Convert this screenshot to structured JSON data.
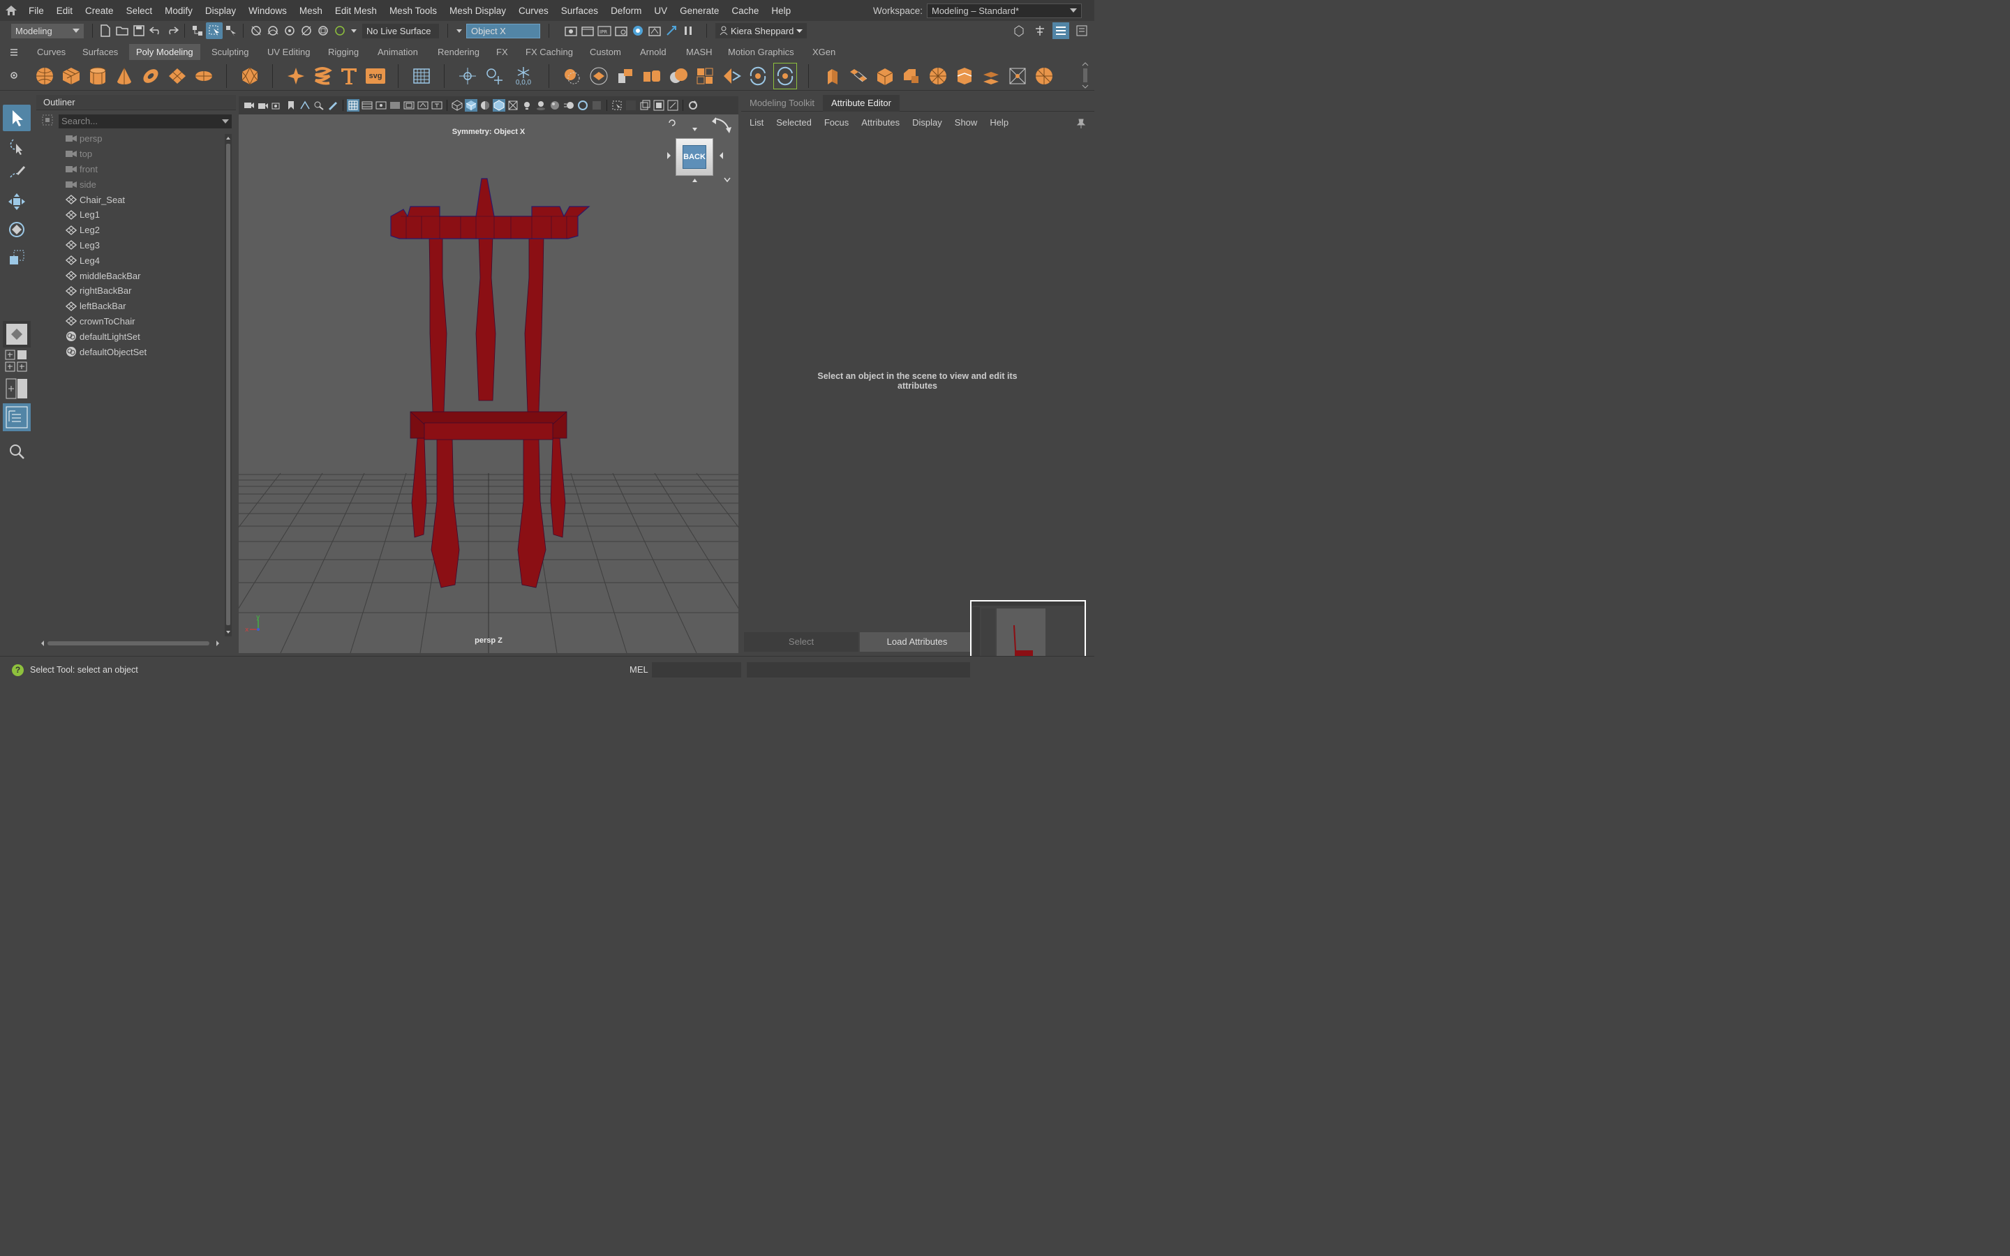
{
  "menubar": {
    "items": [
      "File",
      "Edit",
      "Create",
      "Select",
      "Modify",
      "Display",
      "Windows",
      "Mesh",
      "Edit Mesh",
      "Mesh Tools",
      "Mesh Display",
      "Curves",
      "Surfaces",
      "Deform",
      "UV",
      "Generate",
      "Cache",
      "Help"
    ],
    "workspace_label": "Workspace:",
    "workspace_value": "Modeling – Standard*"
  },
  "statusline": {
    "mode": "Modeling",
    "live_surface": "No Live Surface",
    "symmetry": "Object X",
    "user": "Kiera Sheppard"
  },
  "shelf": {
    "tabs": [
      "Curves",
      "Surfaces",
      "Poly Modeling",
      "Sculpting",
      "UV Editing",
      "Rigging",
      "Animation",
      "Rendering",
      "FX",
      "FX Caching",
      "Custom",
      "Arnold",
      "MASH",
      "Motion Graphics",
      "XGen"
    ],
    "active_tab": "Poly Modeling",
    "coord_label": "0,0,0",
    "svg_label": "svg"
  },
  "outliner": {
    "title": "Outliner",
    "search_placeholder": "Search...",
    "items": [
      {
        "name": "persp",
        "type": "camera"
      },
      {
        "name": "top",
        "type": "camera"
      },
      {
        "name": "front",
        "type": "camera"
      },
      {
        "name": "side",
        "type": "camera"
      },
      {
        "name": "Chair_Seat",
        "type": "mesh"
      },
      {
        "name": "Leg1",
        "type": "mesh"
      },
      {
        "name": "Leg2",
        "type": "mesh"
      },
      {
        "name": "Leg3",
        "type": "mesh"
      },
      {
        "name": "Leg4",
        "type": "mesh"
      },
      {
        "name": "middleBackBar",
        "type": "mesh"
      },
      {
        "name": "rightBackBar",
        "type": "mesh"
      },
      {
        "name": "leftBackBar",
        "type": "mesh"
      },
      {
        "name": "crownToChair",
        "type": "mesh"
      },
      {
        "name": "defaultLightSet",
        "type": "set"
      },
      {
        "name": "defaultObjectSet",
        "type": "set"
      }
    ]
  },
  "viewport": {
    "symmetry_label": "Symmetry: Object X",
    "camera_label": "persp Z",
    "viewcube_face": "BACK",
    "axis_y": "y",
    "axis_x": "x"
  },
  "right_panel": {
    "tabs": [
      "Modeling Toolkit",
      "Attribute Editor"
    ],
    "active_tab": "Attribute Editor",
    "menu": [
      "List",
      "Selected",
      "Focus",
      "Attributes",
      "Display",
      "Show",
      "Help"
    ],
    "message": "Select an object in the scene to view and edit its attributes",
    "select_button": "Select",
    "load_button": "Load Attributes"
  },
  "bottom": {
    "help_text": "Select Tool: select an object",
    "mel_label": "MEL"
  },
  "colors": {
    "accent": "#5285a6",
    "chair": "#8b0f14",
    "shelf_icon": "#e8954a"
  }
}
